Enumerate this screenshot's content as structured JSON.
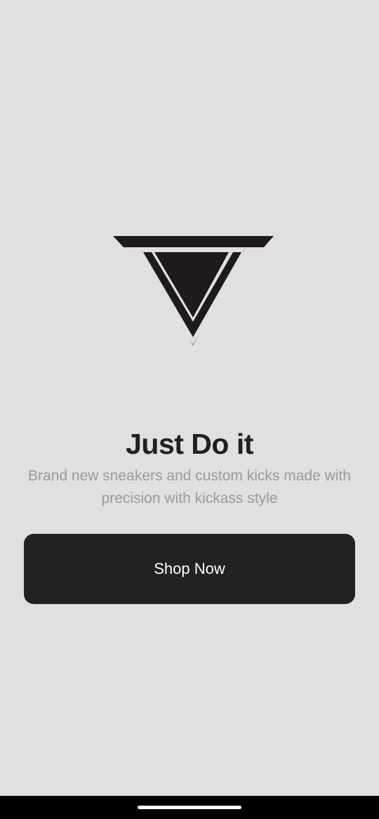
{
  "logo": {
    "icon": "v-chevron-logo-icon",
    "color": "#1f1b1c"
  },
  "hero": {
    "title": "Just Do it",
    "subtitle": "Brand new sneakers and custom kicks made with precision with kickass style"
  },
  "cta": {
    "label": "Shop Now",
    "background": "#222222"
  },
  "system": {
    "nav_bar_color": "#000000",
    "background": "#e0e0e0"
  }
}
